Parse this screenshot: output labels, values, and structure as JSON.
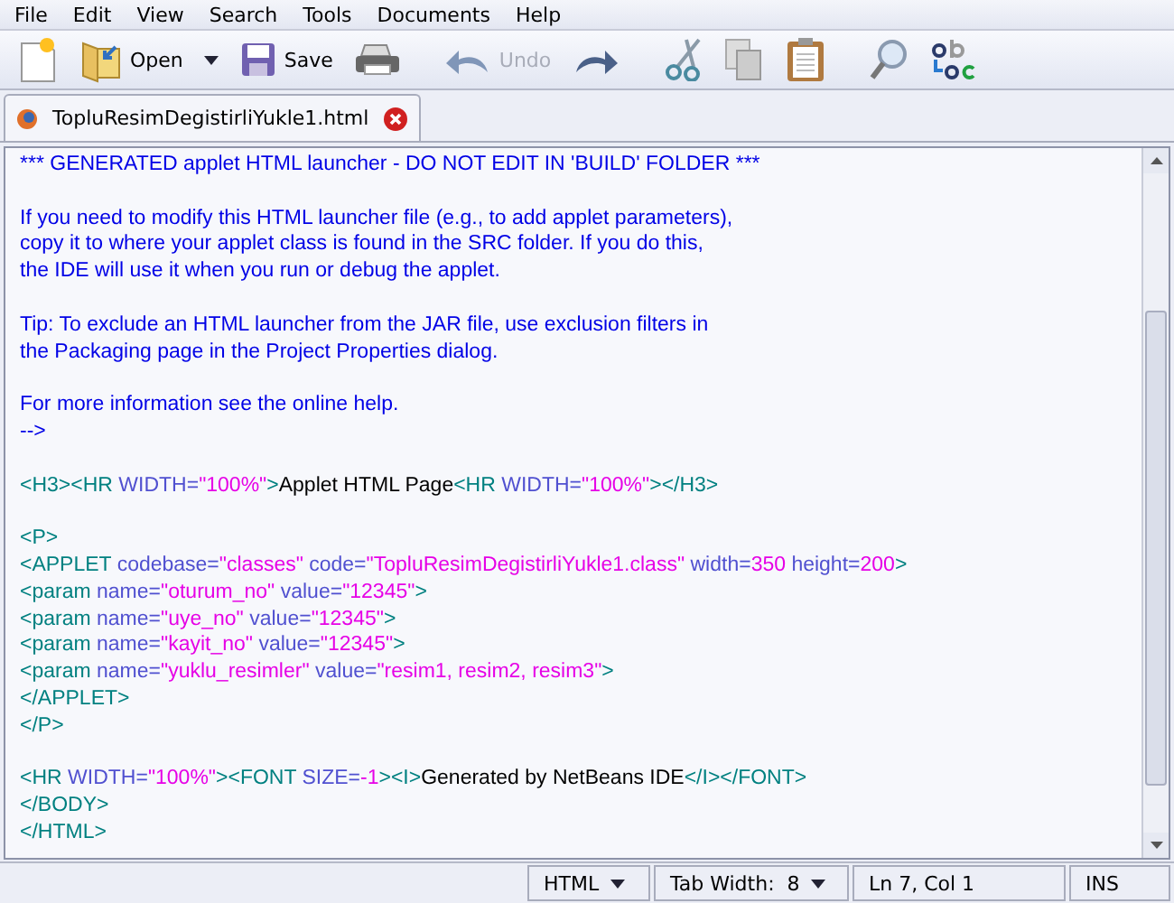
{
  "menu": [
    "File",
    "Edit",
    "View",
    "Search",
    "Tools",
    "Documents",
    "Help"
  ],
  "toolbar": [
    {
      "kind": "new"
    },
    {
      "kind": "open",
      "label": "Open",
      "dropdown": true
    },
    {
      "kind": "save",
      "label": "Save"
    },
    {
      "kind": "print"
    },
    {
      "kind": "undo",
      "label": "Undo",
      "disabled": true
    },
    {
      "kind": "redo"
    },
    {
      "kind": "cut"
    },
    {
      "kind": "copy"
    },
    {
      "kind": "paste"
    },
    {
      "kind": "find"
    },
    {
      "kind": "replace"
    }
  ],
  "tabs": [
    {
      "label": "TopluResimDegistirliYukle1.html",
      "selected": true
    }
  ],
  "code_lines": [
    {
      "kind": "code",
      "tokens": [
        {
          "kind": "comment",
          "text": "*** GENERATED applet HTML launcher - DO NOT EDIT IN 'BUILD' FOLDER ***"
        }
      ]
    },
    {
      "kind": "blank"
    },
    {
      "kind": "code",
      "tokens": [
        {
          "kind": "comment",
          "text": "If you need to modify this HTML launcher file (e.g., to add applet parameters),"
        }
      ]
    },
    {
      "kind": "code",
      "tokens": [
        {
          "kind": "comment",
          "text": "copy it to where your applet class is found in the SRC folder. If you do this,"
        }
      ]
    },
    {
      "kind": "code",
      "tokens": [
        {
          "kind": "comment",
          "text": "the IDE will use it when you run or debug the applet."
        }
      ]
    },
    {
      "kind": "blank"
    },
    {
      "kind": "code",
      "tokens": [
        {
          "kind": "comment",
          "text": "Tip: To exclude an HTML launcher from the JAR file, use exclusion filters in"
        }
      ]
    },
    {
      "kind": "code",
      "tokens": [
        {
          "kind": "comment",
          "text": "the Packaging page in the Project Properties dialog."
        }
      ]
    },
    {
      "kind": "blank"
    },
    {
      "kind": "code",
      "tokens": [
        {
          "kind": "comment",
          "text": "For more information see the online help."
        }
      ]
    },
    {
      "kind": "code",
      "tokens": [
        {
          "kind": "comment",
          "text": "-->"
        }
      ]
    },
    {
      "kind": "blank"
    },
    {
      "kind": "code",
      "tokens": [
        {
          "kind": "tag",
          "text": "<H3><HR "
        },
        {
          "kind": "attr",
          "text": "WIDTH="
        },
        {
          "kind": "value",
          "text": "\"100%\""
        },
        {
          "kind": "tag",
          "text": ">"
        },
        {
          "kind": "text",
          "text": "Applet HTML Page"
        },
        {
          "kind": "tag",
          "text": "<HR "
        },
        {
          "kind": "attr",
          "text": "WIDTH="
        },
        {
          "kind": "value",
          "text": "\"100%\""
        },
        {
          "kind": "tag",
          "text": "></H3>"
        }
      ]
    },
    {
      "kind": "blank"
    },
    {
      "kind": "code",
      "tokens": [
        {
          "kind": "tag",
          "text": "<P>"
        }
      ]
    },
    {
      "kind": "code",
      "tokens": [
        {
          "kind": "tag",
          "text": "<APPLET "
        },
        {
          "kind": "attr",
          "text": "codebase="
        },
        {
          "kind": "value",
          "text": "\"classes\""
        },
        {
          "kind": "attr",
          "text": " code="
        },
        {
          "kind": "value",
          "text": "\"TopluResimDegistirliYukle1.class\""
        },
        {
          "kind": "attr",
          "text": " width="
        },
        {
          "kind": "value",
          "text": "350"
        },
        {
          "kind": "attr",
          "text": " height="
        },
        {
          "kind": "value",
          "text": "200"
        },
        {
          "kind": "tag",
          "text": ">"
        }
      ]
    },
    {
      "kind": "code",
      "tokens": [
        {
          "kind": "tag",
          "text": "<param "
        },
        {
          "kind": "attr",
          "text": "name="
        },
        {
          "kind": "value",
          "text": "\"oturum_no\""
        },
        {
          "kind": "attr",
          "text": " value="
        },
        {
          "kind": "value",
          "text": "\"12345\""
        },
        {
          "kind": "tag",
          "text": ">"
        }
      ]
    },
    {
      "kind": "code",
      "tokens": [
        {
          "kind": "tag",
          "text": "<param "
        },
        {
          "kind": "attr",
          "text": "name="
        },
        {
          "kind": "value",
          "text": "\"uye_no\""
        },
        {
          "kind": "attr",
          "text": " value="
        },
        {
          "kind": "value",
          "text": "\"12345\""
        },
        {
          "kind": "tag",
          "text": ">"
        }
      ]
    },
    {
      "kind": "code",
      "tokens": [
        {
          "kind": "tag",
          "text": "<param "
        },
        {
          "kind": "attr",
          "text": "name="
        },
        {
          "kind": "value",
          "text": "\"kayit_no\""
        },
        {
          "kind": "attr",
          "text": " value="
        },
        {
          "kind": "value",
          "text": "\"12345\""
        },
        {
          "kind": "tag",
          "text": ">"
        }
      ]
    },
    {
      "kind": "code",
      "tokens": [
        {
          "kind": "tag",
          "text": "<param "
        },
        {
          "kind": "attr",
          "text": "name="
        },
        {
          "kind": "value",
          "text": "\"yuklu_resimler\""
        },
        {
          "kind": "attr",
          "text": " value="
        },
        {
          "kind": "value",
          "text": "\"resim1, resim2, resim3\""
        },
        {
          "kind": "tag",
          "text": ">"
        }
      ]
    },
    {
      "kind": "code",
      "tokens": [
        {
          "kind": "tag",
          "text": "</APPLET>"
        }
      ]
    },
    {
      "kind": "code",
      "tokens": [
        {
          "kind": "tag",
          "text": "</P>"
        }
      ]
    },
    {
      "kind": "blank"
    },
    {
      "kind": "code",
      "tokens": [
        {
          "kind": "tag",
          "text": "<HR "
        },
        {
          "kind": "attr",
          "text": "WIDTH="
        },
        {
          "kind": "value",
          "text": "\"100%\""
        },
        {
          "kind": "tag",
          "text": "><FONT "
        },
        {
          "kind": "attr",
          "text": "SIZE="
        },
        {
          "kind": "value",
          "text": "-1"
        },
        {
          "kind": "tag",
          "text": "><I>"
        },
        {
          "kind": "text",
          "text": "Generated by NetBeans IDE"
        },
        {
          "kind": "tag",
          "text": "</I></FONT>"
        }
      ]
    },
    {
      "kind": "code",
      "tokens": [
        {
          "kind": "tag",
          "text": "</BODY>"
        }
      ]
    },
    {
      "kind": "code",
      "tokens": [
        {
          "kind": "tag",
          "text": "</HTML>"
        }
      ]
    }
  ],
  "status_bar": [
    {
      "label": "HTML",
      "dropdown": true
    },
    {
      "label": "Tab Width:  8",
      "dropdown": true
    },
    {
      "label": "Ln 7, Col 1",
      "dropdown": false
    },
    {
      "label": "INS",
      "dropdown": false
    }
  ]
}
